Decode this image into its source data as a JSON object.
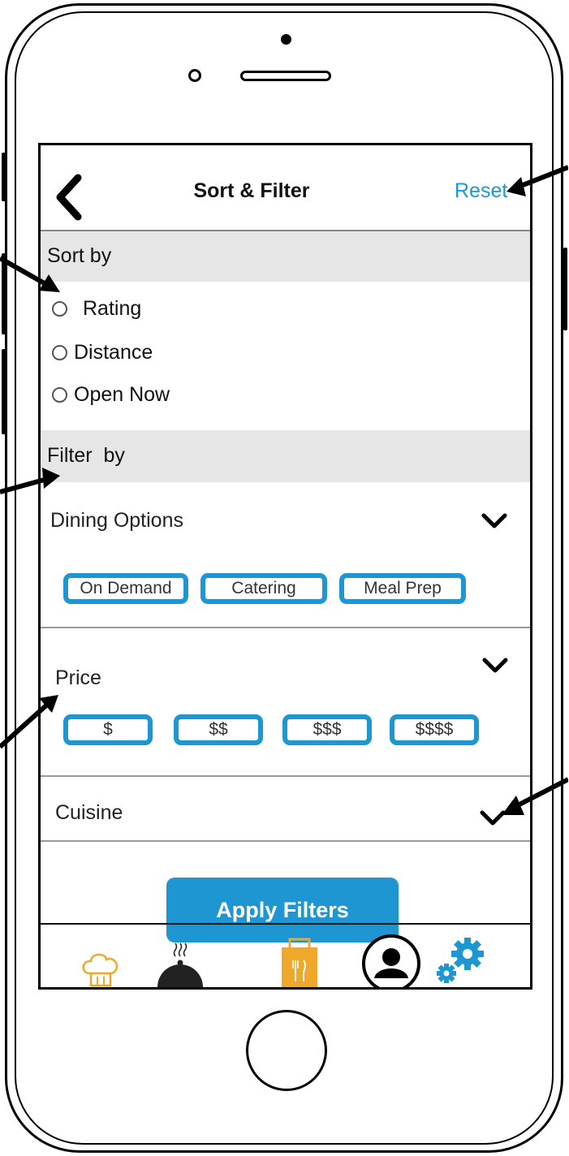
{
  "header": {
    "title": "Sort & Filter",
    "reset_label": "Reset"
  },
  "sort": {
    "heading": "Sort by",
    "options": [
      "Rating",
      "Distance",
      "Open Now"
    ]
  },
  "filter": {
    "heading": "Filter  by",
    "dining": {
      "label": "Dining Options",
      "chips": [
        "On Demand",
        "Catering",
        "Meal Prep"
      ]
    },
    "price": {
      "label": "Price",
      "chips": [
        "$",
        "$$",
        "$$$",
        "$$$$"
      ]
    },
    "cuisine": {
      "label": "Cuisine"
    }
  },
  "apply_label": "Apply Filters",
  "bottom_nav": {
    "items": [
      "chef-hat-icon",
      "food-cloche-icon",
      "restaurant-bag-icon",
      "profile-icon",
      "settings-gears-icon"
    ]
  },
  "colors": {
    "accent": "#1d96d2",
    "bag": "#f0a82a",
    "band": "#e6e6e6"
  }
}
